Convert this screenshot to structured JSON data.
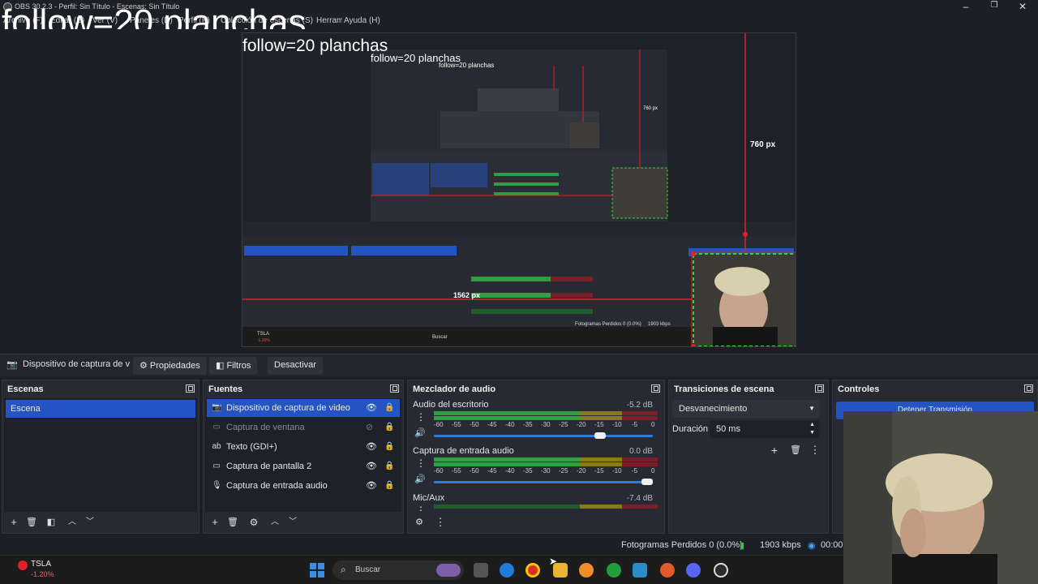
{
  "window": {
    "title": "OBS 30.2.3 - Perfil: Sin Título - Escenas: Sin Título",
    "menu": [
      "Archivo (F)",
      "Editar (E)",
      "Ver (V)",
      "Paneles (D)",
      "Perfil (P)",
      "Colección de escenas (S)",
      "Herramientas (T)",
      "Ayuda (H)"
    ]
  },
  "overlay": {
    "big_text": "follow=20 planchas",
    "mid_text": "follow=20 planchas",
    "small_text": "follow=20 planchas",
    "tiny_text": "follow=20 planchas"
  },
  "preview": {
    "height_label": "760 px",
    "width_label": "1562 px",
    "nested_height_label": "760 px",
    "inner_status": "Fotogramas Perdidos 0 (0.0%)",
    "inner_kbps": "1903 kbps",
    "inner_search": "Buscar",
    "inner_stock": "TSLA",
    "inner_stock_change": "-1.20%"
  },
  "toolbar": {
    "source_name": "Dispositivo de captura de v",
    "properties_label": "Propiedades",
    "filters_label": "Filtros",
    "deactivate_label": "Desactivar"
  },
  "scenes": {
    "title": "Escenas",
    "items": [
      {
        "label": "Escena"
      }
    ]
  },
  "sources": {
    "title": "Fuentes",
    "items": [
      {
        "label": "Dispositivo de captura de video",
        "icon": "camera-icon",
        "visible": true
      },
      {
        "label": "Captura de ventana",
        "icon": "window-icon",
        "visible": false
      },
      {
        "label": "Texto (GDI+)",
        "icon": "text-icon",
        "visible": true
      },
      {
        "label": "Captura de pantalla 2",
        "icon": "monitor-icon",
        "visible": true
      },
      {
        "label": "Captura de entrada audio",
        "icon": "microphone-icon",
        "visible": true
      }
    ]
  },
  "mixer": {
    "title": "Mezclador de audio",
    "ticks": [
      "-60",
      "-55",
      "-50",
      "-45",
      "-40",
      "-35",
      "-30",
      "-25",
      "-20",
      "-15",
      "-10",
      "-5",
      "0"
    ],
    "channels": [
      {
        "name": "Audio del escritorio",
        "db": "-5.2 dB",
        "volume": 0.78
      },
      {
        "name": "Captura de entrada audio",
        "db": "0.0 dB",
        "volume": 0.98
      },
      {
        "name": "Mic/Aux",
        "db": "-7.4 dB",
        "volume": 0.75
      }
    ]
  },
  "transitions": {
    "title": "Transiciones de escena",
    "selected": "Desvanecimiento",
    "duration_label": "Duración",
    "duration_value": "50 ms"
  },
  "controls": {
    "title": "Controles",
    "stop_stream_label": "Detener Transmisión"
  },
  "status": {
    "dropped_frames": "Fotogramas Perdidos 0 (0.0%)",
    "kbps": "1903 kbps",
    "time": "00:00"
  },
  "taskbar": {
    "stock_symbol": "TSLA",
    "stock_change": "-1.20%",
    "search_placeholder": "Buscar"
  },
  "colors": {
    "accent": "#2453c4",
    "panel_bg": "#272a33",
    "app_bg": "#1d1f26",
    "red_guide": "#e0202a",
    "green_crop": "#39d339",
    "meter_green": "#2ea043"
  }
}
